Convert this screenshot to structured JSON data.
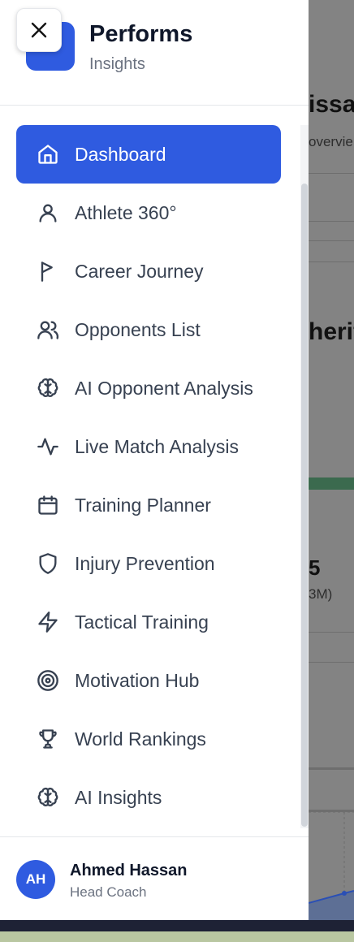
{
  "brand": {
    "title": "Performs",
    "subtitle": "Insights"
  },
  "background": {
    "heading_fragment": "issa",
    "subtext_fragment": "overvie",
    "heading2_fragment": "herif",
    "value_fragment": "5",
    "paren_fragment": "3M)"
  },
  "nav": {
    "items": [
      {
        "label": "Dashboard",
        "icon": "home-icon",
        "active": true
      },
      {
        "label": "Athlete 360°",
        "icon": "user-icon"
      },
      {
        "label": "Career Journey",
        "icon": "flag-icon"
      },
      {
        "label": "Opponents List",
        "icon": "users-icon"
      },
      {
        "label": "AI Opponent Analysis",
        "icon": "brain-icon"
      },
      {
        "label": "Live Match Analysis",
        "icon": "activity-icon"
      },
      {
        "label": "Training Planner",
        "icon": "calendar-icon"
      },
      {
        "label": "Injury Prevention",
        "icon": "shield-icon"
      },
      {
        "label": "Tactical Training",
        "icon": "zap-icon"
      },
      {
        "label": "Motivation Hub",
        "icon": "target-icon"
      },
      {
        "label": "World Rankings",
        "icon": "trophy-icon"
      },
      {
        "label": "AI Insights",
        "icon": "brain-icon"
      }
    ]
  },
  "user": {
    "initials": "AH",
    "name": "Ahmed Hassan",
    "role": "Head Coach"
  },
  "colors": {
    "accent": "#2f5be0",
    "overlay": "#838383"
  }
}
